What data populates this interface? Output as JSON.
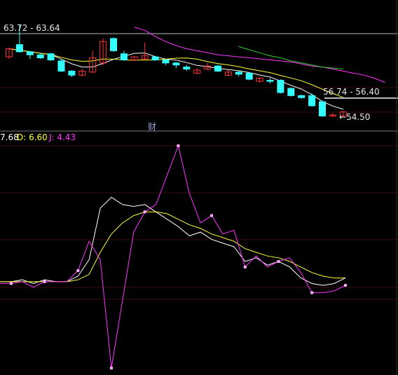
{
  "price_chart": {
    "high_label": "63.72 - 63.64",
    "mid_label": "56.74 - 56.40",
    "low_label": "54.50",
    "event_marker": "财",
    "colors": {
      "up": "#ff3333",
      "down": "#33ffff",
      "ma5": "#ffffff",
      "ma10": "#ffff33",
      "ma20": "#ff33ff",
      "ma60": "#33cc33"
    },
    "candles": [
      {
        "o": 60.4,
        "c": 61.2,
        "h": 61.3,
        "l": 60.2
      },
      {
        "o": 61.6,
        "c": 60.9,
        "h": 63.6,
        "l": 60.8
      },
      {
        "o": 60.9,
        "c": 60.6,
        "h": 61.0,
        "l": 60.2
      },
      {
        "o": 60.6,
        "c": 60.3,
        "h": 60.8,
        "l": 60.2
      },
      {
        "o": 60.7,
        "c": 60.1,
        "h": 60.8,
        "l": 60.0
      },
      {
        "o": 60.0,
        "c": 59.0,
        "h": 60.2,
        "l": 58.9
      },
      {
        "o": 59.0,
        "c": 58.6,
        "h": 59.1,
        "l": 58.4
      },
      {
        "o": 58.6,
        "c": 59.0,
        "h": 59.2,
        "l": 58.5
      },
      {
        "o": 58.9,
        "c": 60.3,
        "h": 61.0,
        "l": 58.8
      },
      {
        "o": 59.8,
        "c": 61.9,
        "h": 62.2,
        "l": 59.6
      },
      {
        "o": 62.2,
        "c": 61.0,
        "h": 62.3,
        "l": 60.9
      },
      {
        "o": 60.7,
        "c": 60.1,
        "h": 61.0,
        "l": 60.0
      },
      {
        "o": 60.1,
        "c": 60.4,
        "h": 60.5,
        "l": 60.0
      },
      {
        "o": 60.2,
        "c": 60.5,
        "h": 61.8,
        "l": 60.1
      },
      {
        "o": 60.4,
        "c": 60.1,
        "h": 60.5,
        "l": 60.0
      },
      {
        "o": 60.1,
        "c": 59.8,
        "h": 60.2,
        "l": 59.6
      },
      {
        "o": 59.8,
        "c": 59.6,
        "h": 59.9,
        "l": 59.3
      },
      {
        "o": 59.4,
        "c": 59.2,
        "h": 59.6,
        "l": 59.0
      },
      {
        "o": 58.8,
        "c": 59.1,
        "h": 59.3,
        "l": 58.7
      },
      {
        "o": 59.2,
        "c": 59.5,
        "h": 59.8,
        "l": 59.1
      },
      {
        "o": 59.5,
        "c": 59.0,
        "h": 59.6,
        "l": 58.9
      },
      {
        "o": 58.6,
        "c": 58.9,
        "h": 59.1,
        "l": 58.5
      },
      {
        "o": 58.9,
        "c": 58.7,
        "h": 59.0,
        "l": 58.5
      },
      {
        "o": 58.8,
        "c": 58.2,
        "h": 58.9,
        "l": 58.1
      },
      {
        "o": 58.0,
        "c": 58.3,
        "h": 58.4,
        "l": 57.9
      },
      {
        "o": 58.1,
        "c": 58.0,
        "h": 58.3,
        "l": 57.8
      },
      {
        "o": 58.1,
        "c": 56.9,
        "h": 58.2,
        "l": 56.8
      },
      {
        "o": 57.3,
        "c": 56.6,
        "h": 57.4,
        "l": 56.5
      },
      {
        "o": 56.6,
        "c": 56.4,
        "h": 56.7,
        "l": 56.3
      },
      {
        "o": 56.6,
        "c": 55.6,
        "h": 56.8,
        "l": 55.5
      },
      {
        "o": 56.0,
        "c": 54.6,
        "h": 56.1,
        "l": 54.5
      },
      {
        "o": 54.6,
        "c": 54.7,
        "h": 54.9,
        "l": 54.5
      },
      {
        "o": 54.6,
        "c": 55.0,
        "h": 55.1,
        "l": 54.5
      }
    ]
  },
  "kdj": {
    "k_label": "7.68",
    "d_label": "D: 6.60",
    "j_label": "J: 4.43",
    "k": [
      50,
      50,
      51,
      49,
      51,
      50,
      50,
      53,
      62,
      90,
      96,
      92,
      91,
      92,
      88,
      84,
      80,
      75,
      77,
      73,
      71,
      69,
      61,
      63,
      59,
      61,
      58,
      52,
      49,
      48,
      49,
      52
    ],
    "d": [
      50,
      50,
      50,
      50,
      50,
      50,
      50,
      51,
      54,
      66,
      76,
      82,
      86,
      88,
      88,
      87,
      84,
      81,
      79,
      76,
      74,
      72,
      68,
      66,
      64,
      63,
      61,
      58,
      55,
      53,
      52,
      52
    ],
    "j": [
      49,
      49,
      50,
      47,
      50,
      50,
      50,
      56,
      72,
      62,
      3,
      40,
      77,
      88,
      92,
      108,
      124,
      98,
      82,
      86,
      76,
      78,
      58,
      64,
      58,
      61,
      63,
      55,
      44,
      44,
      45,
      48
    ]
  }
}
